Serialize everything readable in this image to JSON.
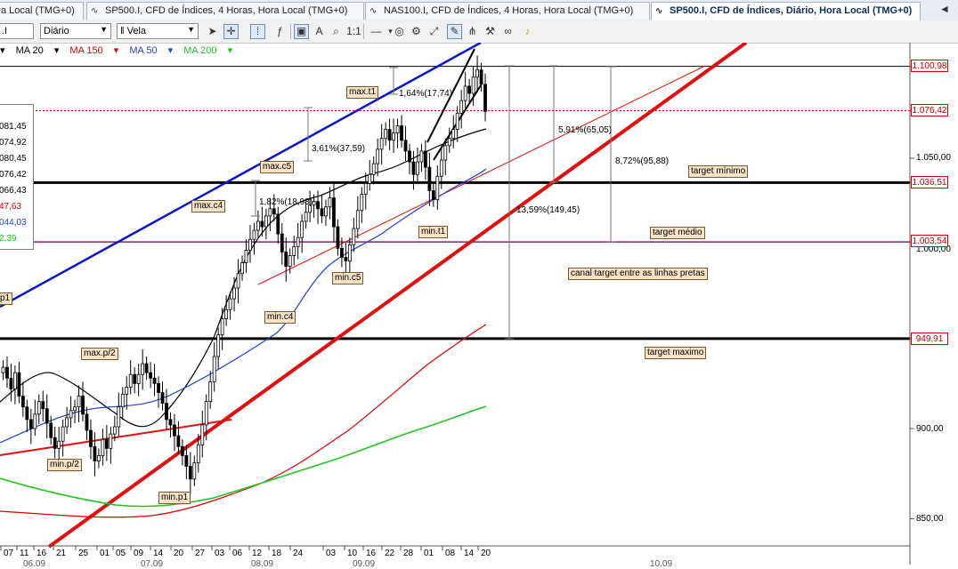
{
  "tabs": [
    {
      "label": "a Local (TMG+0)",
      "active": false
    },
    {
      "label": "SP500.I, CFD de Índices, 4 Horas, Hora Local (TMG+0)",
      "active": false
    },
    {
      "label": "NAS100.I, CFD de Índices, 4 Horas, Hora Local (TMG+0)",
      "active": false
    },
    {
      "label": "SP500.I, CFD de Índices, Diário, Hora Local (TMG+0)",
      "active": true
    }
  ],
  "toolbar": {
    "symbol": ".I",
    "timeframe": "Diário",
    "chart_type": "Vela",
    "icons": [
      "cursor-icon",
      "crosshair-icon",
      "dotted-grid-icon",
      "indicator-icon",
      "data-window-icon",
      "text-icon",
      "zoom-in-icon",
      "zoom-reset-icon",
      "hline-icon",
      "marker-icon",
      "gear-icon",
      "draw-icon",
      "pencil-icon",
      "magnet-icon",
      "settings-icon",
      "bell-icon"
    ]
  },
  "legend": [
    {
      "label": "MA 20",
      "color": "#000000"
    },
    {
      "label": "MA 150",
      "color": "#e00000"
    },
    {
      "label": "MA 50",
      "color": "#1f3fd8"
    },
    {
      "label": "MA 200",
      "color": "#22c322"
    }
  ],
  "infobox": [
    "081,45",
    "074,92",
    "080,45",
    "076,42",
    "066,43",
    "47,63",
    "044,03",
    "2.39"
  ],
  "annotations": {
    "max_t1": "max.t1",
    "max_c5": "max.c5",
    "max_c4": "max.c4",
    "min_t1": "min.t1",
    "min_c5": "min.c5",
    "min_c4": "min.c4",
    "max_p2": "max.p/2",
    "min_p2": "min.p/2",
    "min_p1": "min.p1",
    "p1_left": "p1",
    "target_minimo": "target mínimo",
    "target_medio": "target médio",
    "target_maximo": "target maximo",
    "canal": "canal target entre as linhas pretas"
  },
  "measures": {
    "m1": "1,64%(17,74)",
    "m2": "3,61%(37,59)",
    "m3": "1,82%(18,98)",
    "m4": "5,91%(65,05)",
    "m5": "8,72%(95,88)",
    "m6": "13,59%(149,45)"
  },
  "price_axis": {
    "labels": [
      "1.050,00",
      "900,00",
      "850,00",
      "1.000,00"
    ],
    "boxes": [
      "1.100,98",
      "1.076,42",
      "1.036,51",
      "1.003,54",
      "949,91"
    ],
    "box_color": "#d00000"
  },
  "date_axis": {
    "days": [
      "07",
      "11",
      "16",
      "21",
      "25",
      "01",
      "05",
      "09",
      "14",
      "20",
      "27",
      "03",
      "06",
      "12",
      "18",
      "24",
      "03",
      "10",
      "16",
      "22",
      "28",
      "01",
      "08",
      "14",
      "20"
    ],
    "months": [
      "06.09",
      "07.09",
      "08.09",
      "09.09",
      "10.09"
    ]
  },
  "chart_data": {
    "type": "candlestick",
    "price_min": 840,
    "price_max": 1120,
    "horizontal_levels": [
      {
        "price": 1100.98,
        "style": "solid-thin",
        "color": "#000000"
      },
      {
        "price": 1076.42,
        "style": "dotted",
        "color": "#d00000"
      },
      {
        "price": 1036.51,
        "style": "solid-thick",
        "color": "#000000"
      },
      {
        "price": 1003.54,
        "style": "solid",
        "color": "#7d2a6e"
      },
      {
        "price": 949.91,
        "style": "solid-thick",
        "color": "#000000"
      }
    ],
    "closes": [
      934,
      928,
      922,
      931,
      918,
      912,
      905,
      900,
      908,
      915,
      911,
      903,
      895,
      889,
      893,
      901,
      906,
      910,
      912,
      918,
      908,
      899,
      890,
      882,
      885,
      894,
      889,
      897,
      901,
      912,
      919,
      923,
      930,
      925,
      930,
      936,
      931,
      928,
      925,
      920,
      914,
      905,
      902,
      896,
      890,
      885,
      879,
      872,
      881,
      891,
      902,
      915,
      926,
      940,
      952,
      961,
      966,
      972,
      978,
      986,
      992,
      999,
      1005,
      1010,
      1015,
      1012,
      1018,
      1022,
      1019,
      1008,
      998,
      990,
      996,
      1001,
      1006,
      1015,
      1020,
      1024,
      1026,
      1022,
      1018,
      1023,
      1028,
      1012,
      1000,
      995,
      993,
      1002,
      1011,
      1021,
      1030,
      1036,
      1041,
      1047,
      1055,
      1061,
      1066,
      1060,
      1064,
      1068,
      1060,
      1054,
      1048,
      1041,
      1048,
      1054,
      1045,
      1032,
      1027,
      1040,
      1049,
      1057,
      1061,
      1066,
      1075,
      1082,
      1090,
      1086,
      1095,
      1099,
      1091,
      1076
    ]
  }
}
